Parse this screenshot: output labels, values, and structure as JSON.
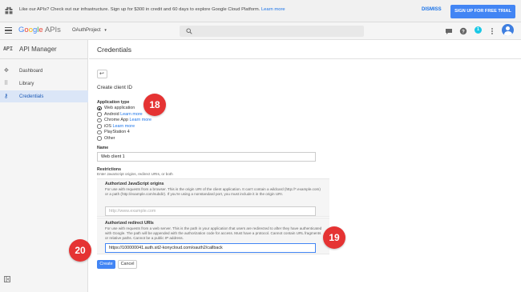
{
  "banner": {
    "message": "Like our APIs? Check out our infrastructure. Sign up for $300 in credit and 60 days to explore Google Cloud Platform.",
    "learn_more": "Learn more",
    "dismiss": "DISMISS",
    "signup": "SIGN UP FOR FREE TRIAL"
  },
  "topbar": {
    "logo": {
      "g1": "G",
      "g2": "o",
      "g3": "o",
      "g4": "g",
      "g5": "l",
      "g6": "e",
      "apis": " APIs"
    },
    "project": "OAuthProject",
    "project_caret": "▾",
    "notification_count": "1"
  },
  "sidebar": {
    "api_glyph": "API",
    "title": "API Manager",
    "items": [
      {
        "label": "Dashboard",
        "icon": "dashboard-icon",
        "glyph": "✥"
      },
      {
        "label": "Library",
        "icon": "library-icon",
        "glyph": "⠿"
      },
      {
        "label": "Credentials",
        "icon": "key-icon",
        "glyph": "⚷"
      }
    ]
  },
  "page": {
    "title": "Credentials",
    "back_glyph": "↩",
    "section_title": "Create client ID",
    "application_type": {
      "label": "Application type",
      "options": [
        {
          "label": "Web application",
          "link": "",
          "selected": true
        },
        {
          "label": "Android",
          "link": "Learn more",
          "selected": false
        },
        {
          "label": "Chrome App",
          "link": "Learn more",
          "selected": false
        },
        {
          "label": "iOS",
          "link": "Learn more",
          "selected": false
        },
        {
          "label": "PlayStation 4",
          "link": "",
          "selected": false
        },
        {
          "label": "Other",
          "link": "",
          "selected": false
        }
      ]
    },
    "name": {
      "label": "Name",
      "value": "Web client 1"
    },
    "restrictions": {
      "label": "Restrictions",
      "hint": "Enter JavaScript origins, redirect URIs, or both",
      "js_origins": {
        "label": "Authorized JavaScript origins",
        "desc": "For use with requests from a browser. This is the origin URI of the client application. It can't contain a wildcard (http://*.example.com) or a path (http://example.com/subdir). If you're using a nonstandard port, you must include it in the origin URI.",
        "placeholder": "http://www.example.com"
      },
      "redirect_uris": {
        "label": "Authorized redirect URIs",
        "desc": "For use with requests from a web server. This is the path in your application that users are redirected to after they have authenticated with Google. The path will be appended with the authorization code for access. Must have a protocol. Cannot contain URL fragments or relative paths. Cannot be a public IP address.",
        "value": "https://100000041.auth.sit2-konycloud.com/oauth2/callback"
      }
    },
    "create": "Create",
    "cancel": "Cancel"
  },
  "callouts": [
    "18",
    "19",
    "20"
  ],
  "colors": {
    "accent": "#4285f4",
    "callout": "#e53333",
    "active_nav": "#dbe6f7"
  }
}
